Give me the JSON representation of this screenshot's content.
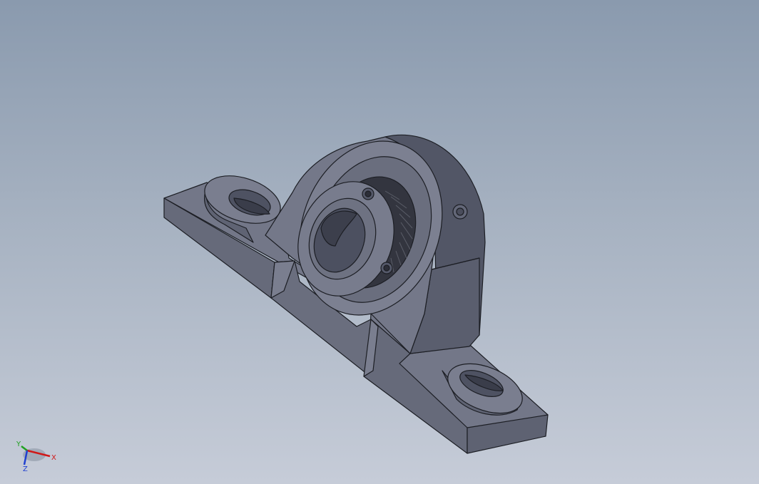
{
  "viewport": {
    "background_top": "#8a9aae",
    "background_bottom": "#c6ccd8",
    "model_color": "#6e7282"
  },
  "triad": {
    "x_label": "X",
    "y_label": "Y",
    "z_label": "Z",
    "x_color": "#d01818",
    "y_color": "#20a020",
    "z_color": "#2040d0"
  }
}
